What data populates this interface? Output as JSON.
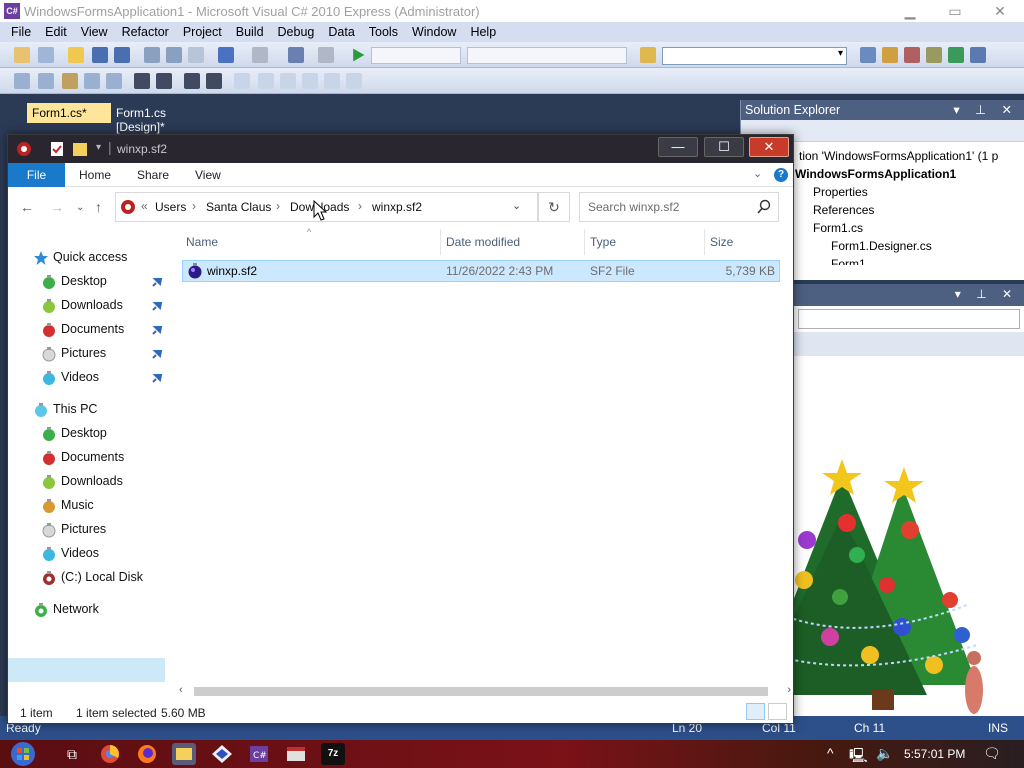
{
  "vs": {
    "title": "WindowsFormsApplication1 - Microsoft Visual C# 2010 Express (Administrator)",
    "logo": "C#",
    "menu": [
      "File",
      "Edit",
      "View",
      "Refactor",
      "Project",
      "Build",
      "Debug",
      "Data",
      "Tools",
      "Window",
      "Help"
    ],
    "tabs": {
      "active": "Form1.cs*",
      "inactive": "Form1.cs [Design]*"
    },
    "solution_explorer": {
      "title": "Solution Explorer",
      "rows": [
        "tion 'WindowsFormsApplication1' (1 p",
        "WindowsFormsApplication1",
        "Properties",
        "References",
        "Form1.cs",
        "Form1.Designer.cs",
        "Form1"
      ]
    },
    "status": {
      "ready": "Ready",
      "ln": "Ln 20",
      "col": "Col 11",
      "ch": "Ch 11",
      "ins": "INS"
    }
  },
  "explorer": {
    "title": "winxp.sf2",
    "ribbon": {
      "file": "File",
      "home": "Home",
      "share": "Share",
      "view": "View",
      "help": "?"
    },
    "address": {
      "overflow": "«",
      "crumbs": [
        "Users",
        "Santa Claus",
        "Downloads",
        "winxp.sf2"
      ]
    },
    "search_placeholder": "Search winxp.sf2",
    "columns": {
      "name": "Name",
      "date": "Date modified",
      "type": "Type",
      "size": "Size"
    },
    "files": [
      {
        "name": "winxp.sf2",
        "date": "11/26/2022 2:43 PM",
        "type": "SF2 File",
        "size": "5,739 KB"
      }
    ],
    "nav": {
      "quick_access": "Quick access",
      "quick_items": [
        "Desktop",
        "Downloads",
        "Documents",
        "Pictures",
        "Videos"
      ],
      "this_pc": "This PC",
      "pc_items": [
        "Desktop",
        "Documents",
        "Downloads",
        "Music",
        "Pictures",
        "Videos",
        "(C:) Local Disk"
      ],
      "network": "Network"
    },
    "status": {
      "count": "1 item",
      "selected": "1 item selected",
      "size": "5.60 MB"
    }
  },
  "taskbar": {
    "clock": "5:57:01 PM"
  },
  "colors": {
    "explorer_accent": "#1979ca",
    "selection": "#cce8ff",
    "vs_header": "#4d6082",
    "taskbar": "#7a1218"
  }
}
